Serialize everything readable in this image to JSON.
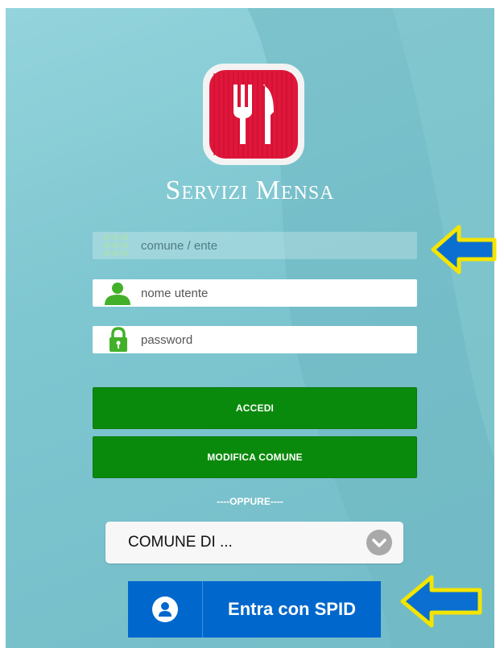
{
  "brand": {
    "name": "Servizi Mensa",
    "logo_icon": "fork-knife-icon",
    "logo_color": "#e0163b"
  },
  "form": {
    "comune": {
      "placeholder": "comune / ente",
      "icon": "grid-icon"
    },
    "username": {
      "placeholder": "nome utente",
      "icon": "user-icon"
    },
    "password": {
      "placeholder": "password",
      "icon": "lock-icon"
    },
    "accedi_label": "ACCEDI",
    "modifica_label": "MODIFICA COMUNE",
    "button_color": "#0a8a0c"
  },
  "separator": "----OPPURE----",
  "comune_select": {
    "value": "COMUNE DI ...",
    "icon": "chevron-down-icon"
  },
  "spid": {
    "label": "Entra con SPID",
    "icon": "spid-user-icon",
    "color": "#0067cc"
  },
  "annotations": {
    "arrow_color": "#0a6fd0",
    "arrow_outline": "#f4e400"
  }
}
